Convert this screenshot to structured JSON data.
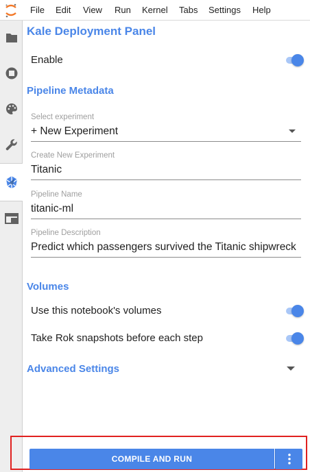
{
  "menu": [
    "File",
    "Edit",
    "View",
    "Run",
    "Kernel",
    "Tabs",
    "Settings",
    "Help"
  ],
  "sidebar": {
    "items": [
      {
        "icon": "folder-icon"
      },
      {
        "icon": "stop-circle-icon"
      },
      {
        "icon": "palette-icon"
      },
      {
        "icon": "wrench-icon"
      },
      {
        "icon": "kale-icon",
        "active": true
      },
      {
        "icon": "tab-window-icon"
      }
    ]
  },
  "panel": {
    "title": "Kale Deployment Panel",
    "enable_label": "Enable",
    "enable_on": true,
    "metadata_heading": "Pipeline Metadata",
    "experiment": {
      "label": "Select experiment",
      "value": "+ New Experiment"
    },
    "new_experiment": {
      "label": "Create New Experiment",
      "value": "Titanic"
    },
    "pipeline_name": {
      "label": "Pipeline Name",
      "value": "titanic-ml"
    },
    "pipeline_description": {
      "label": "Pipeline Description",
      "value": "Predict which passengers survived the Titanic shipwreck"
    },
    "volumes_heading": "Volumes",
    "use_volumes_label": "Use this notebook's volumes",
    "use_volumes_on": true,
    "snapshots_label": "Take Rok snapshots before each step",
    "snapshots_on": true,
    "advanced_heading": "Advanced Settings"
  },
  "compile": {
    "label": "COMPILE AND RUN",
    "more_icon": "more-vertical-icon"
  },
  "colors": {
    "accent": "#4a86e8",
    "highlight": "#e0201f"
  }
}
